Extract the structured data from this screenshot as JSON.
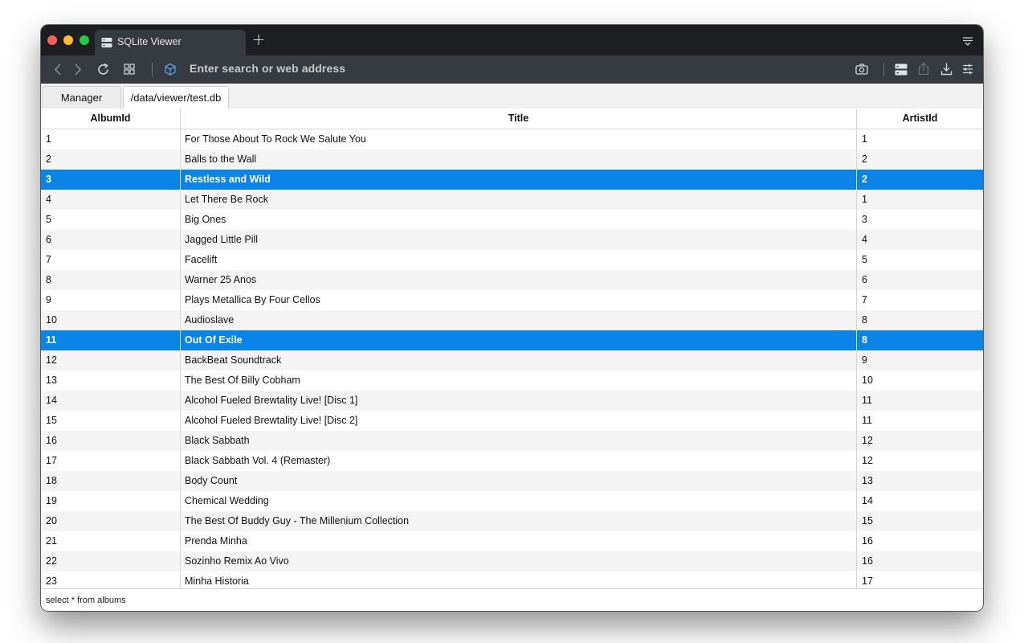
{
  "browser": {
    "tab_title": "SQLite Viewer",
    "new_tab_label": "+",
    "address_placeholder": "Enter search or web address"
  },
  "app": {
    "tabs": [
      {
        "label": "Manager",
        "active": false
      },
      {
        "label": "/data/viewer/test.db",
        "active": true
      }
    ]
  },
  "table": {
    "columns": [
      "AlbumId",
      "Title",
      "ArtistId"
    ],
    "selected_rows": [
      3,
      11
    ],
    "rows": [
      [
        "1",
        "For Those About To Rock We Salute You",
        "1"
      ],
      [
        "2",
        "Balls to the Wall",
        "2"
      ],
      [
        "3",
        "Restless and Wild",
        "2"
      ],
      [
        "4",
        "Let There Be Rock",
        "1"
      ],
      [
        "5",
        "Big Ones",
        "3"
      ],
      [
        "6",
        "Jagged Little Pill",
        "4"
      ],
      [
        "7",
        "Facelift",
        "5"
      ],
      [
        "8",
        "Warner 25 Anos",
        "6"
      ],
      [
        "9",
        "Plays Metallica By Four Cellos",
        "7"
      ],
      [
        "10",
        "Audioslave",
        "8"
      ],
      [
        "11",
        "Out Of Exile",
        "8"
      ],
      [
        "12",
        "BackBeat Soundtrack",
        "9"
      ],
      [
        "13",
        "The Best Of Billy Cobham",
        "10"
      ],
      [
        "14",
        "Alcohol Fueled Brewtality Live! [Disc 1]",
        "11"
      ],
      [
        "15",
        "Alcohol Fueled Brewtality Live! [Disc 2]",
        "11"
      ],
      [
        "16",
        "Black Sabbath",
        "12"
      ],
      [
        "17",
        "Black Sabbath Vol. 4 (Remaster)",
        "12"
      ],
      [
        "18",
        "Body Count",
        "13"
      ],
      [
        "19",
        "Chemical Wedding",
        "14"
      ],
      [
        "20",
        "The Best Of Buddy Guy - The Millenium Collection",
        "15"
      ],
      [
        "21",
        "Prenda Minha",
        "16"
      ],
      [
        "22",
        "Sozinho Remix Ao Vivo",
        "16"
      ],
      [
        "23",
        "Minha Historia",
        "17"
      ]
    ]
  },
  "status": {
    "query": "select * from albums"
  },
  "icons": {
    "tab": "database-icon",
    "back": "chevron-left-icon",
    "forward": "chevron-right-icon",
    "reload": "reload-icon",
    "tabs_overview": "grid-icon",
    "site": "cube-icon",
    "screenshot": "camera-icon",
    "database": "database-icon",
    "share": "share-icon",
    "download": "download-icon",
    "settings": "sliders-icon",
    "tab_menu": "tab-menu-icon"
  },
  "colors": {
    "selection": "#0a84e6",
    "titlebar": "#1c1e22",
    "toolbar": "#363a41"
  }
}
